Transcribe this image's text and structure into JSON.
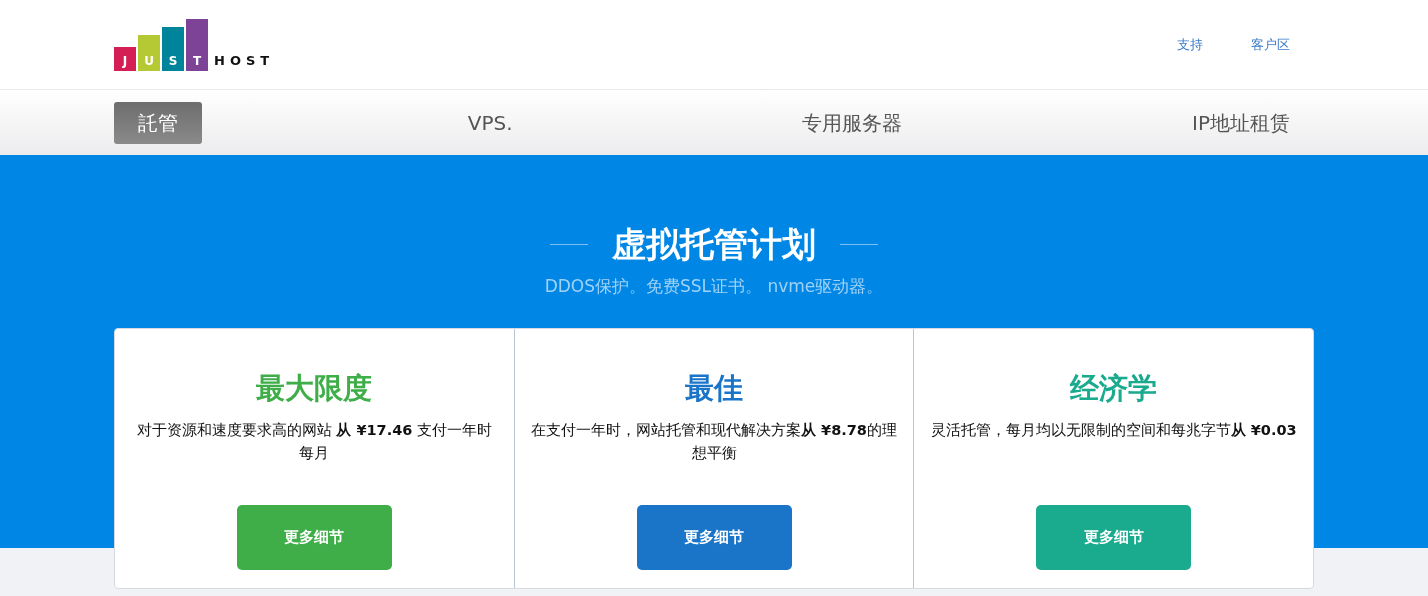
{
  "logo": {
    "letters": [
      {
        "text": "J",
        "color": "#d41f56"
      },
      {
        "text": "U",
        "color": "#b5c934"
      },
      {
        "text": "S",
        "color": "#00849b"
      },
      {
        "text": "T",
        "color": "#7d4397"
      }
    ],
    "suffix": "HOST"
  },
  "top_links": [
    "支持",
    "客户区"
  ],
  "nav": [
    {
      "label": "託管",
      "selected": true
    },
    {
      "label": "VPS.",
      "selected": false
    },
    {
      "label": "专用服务器",
      "selected": false
    },
    {
      "label": "IP地址租赁",
      "selected": false
    }
  ],
  "hero": {
    "title": "虚拟托管计划",
    "subtitle": "DDOS保护。免费SSL证书。 nvme驱动器。"
  },
  "plans": [
    {
      "title": "最大限度",
      "color": "#3fae49",
      "description": "对于资源和速度要求高的网站 **从 ¥17.46** 支付一年时每月",
      "button": "更多细节"
    },
    {
      "title": "最佳",
      "color": "#1a75c8",
      "description": "在支付一年时，网站托管和现代解决方案**从 ¥8.78**的理想平衡",
      "button": "更多细节"
    },
    {
      "title": "经济学",
      "color": "#1aaa8e",
      "description": "灵活托管，每月均以无限制的空间和每兆字节**从 ¥0.03**",
      "button": "更多细节"
    }
  ]
}
